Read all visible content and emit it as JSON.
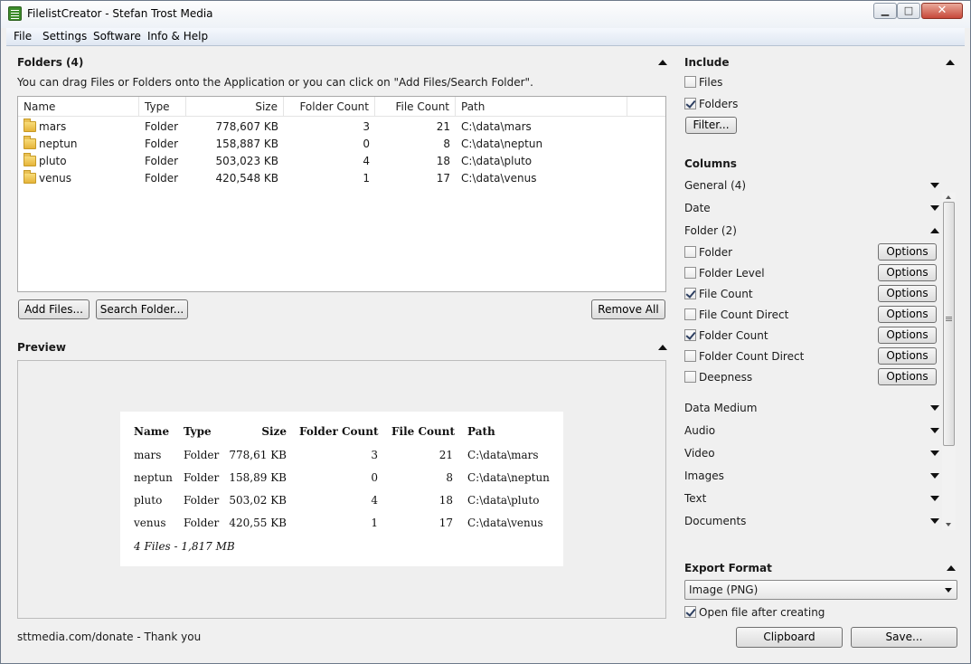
{
  "window": {
    "title": "FilelistCreator - Stefan Trost Media",
    "minimize_glyph": "▁",
    "maximize_glyph": "□",
    "close_glyph": "✕"
  },
  "menu": [
    "File",
    "Settings",
    "Software",
    "Info & Help"
  ],
  "folders": {
    "title": "Folders (4)",
    "hint": "You can drag Files or Folders onto the Application or you can click on \"Add Files/Search Folder\".",
    "columns": [
      "Name",
      "Type",
      "Size",
      "Folder Count",
      "File Count",
      "Path"
    ],
    "rows": [
      {
        "name": "mars",
        "type": "Folder",
        "size": "778,607 KB",
        "folder_count": "3",
        "file_count": "21",
        "path": "C:\\data\\mars"
      },
      {
        "name": "neptun",
        "type": "Folder",
        "size": "158,887 KB",
        "folder_count": "0",
        "file_count": "8",
        "path": "C:\\data\\neptun"
      },
      {
        "name": "pluto",
        "type": "Folder",
        "size": "503,023 KB",
        "folder_count": "4",
        "file_count": "18",
        "path": "C:\\data\\pluto"
      },
      {
        "name": "venus",
        "type": "Folder",
        "size": "420,548 KB",
        "folder_count": "1",
        "file_count": "17",
        "path": "C:\\data\\venus"
      }
    ],
    "buttons": {
      "add_files": "Add Files...",
      "search_folder": "Search Folder...",
      "remove_all": "Remove All"
    }
  },
  "preview": {
    "title": "Preview",
    "columns": [
      "Name",
      "Type",
      "Size",
      "Folder Count",
      "File Count",
      "Path"
    ],
    "rows": [
      {
        "name": "mars",
        "type": "Folder",
        "size": "778,61 KB",
        "folder_count": "3",
        "file_count": "21",
        "path": "C:\\data\\mars"
      },
      {
        "name": "neptun",
        "type": "Folder",
        "size": "158,89 KB",
        "folder_count": "0",
        "file_count": "8",
        "path": "C:\\data\\neptun"
      },
      {
        "name": "pluto",
        "type": "Folder",
        "size": "503,02 KB",
        "folder_count": "4",
        "file_count": "18",
        "path": "C:\\data\\pluto"
      },
      {
        "name": "venus",
        "type": "Folder",
        "size": "420,55 KB",
        "folder_count": "1",
        "file_count": "17",
        "path": "C:\\data\\venus"
      }
    ],
    "summary": "4 Files - 1,817 MB"
  },
  "footer": {
    "donate": "sttmedia.com/donate - Thank you"
  },
  "include": {
    "title": "Include",
    "files": {
      "label": "Files",
      "checked": false
    },
    "folders": {
      "label": "Folders",
      "checked": true
    },
    "filter_button": "Filter..."
  },
  "columns_panel": {
    "title": "Columns",
    "groups_top": [
      "General (4)",
      "Date",
      "Folder (2)"
    ],
    "folder_items": [
      {
        "label": "Folder",
        "checked": false,
        "button": "Options"
      },
      {
        "label": "Folder Level",
        "checked": false,
        "button": "Options"
      },
      {
        "label": "File Count",
        "checked": true,
        "button": "Options"
      },
      {
        "label": "File Count Direct",
        "checked": false,
        "button": "Options"
      },
      {
        "label": "Folder Count",
        "checked": true,
        "button": "Options"
      },
      {
        "label": "Folder Count Direct",
        "checked": false,
        "button": "Options"
      },
      {
        "label": "Deepness",
        "checked": false,
        "button": "Options"
      }
    ],
    "groups_bottom": [
      "Data Medium",
      "Audio",
      "Video",
      "Images",
      "Text",
      "Documents"
    ]
  },
  "export": {
    "title": "Export Format",
    "format": "Image (PNG)",
    "open_after": {
      "label": "Open file after creating",
      "checked": true
    },
    "clipboard_button": "Clipboard",
    "save_button": "Save..."
  }
}
